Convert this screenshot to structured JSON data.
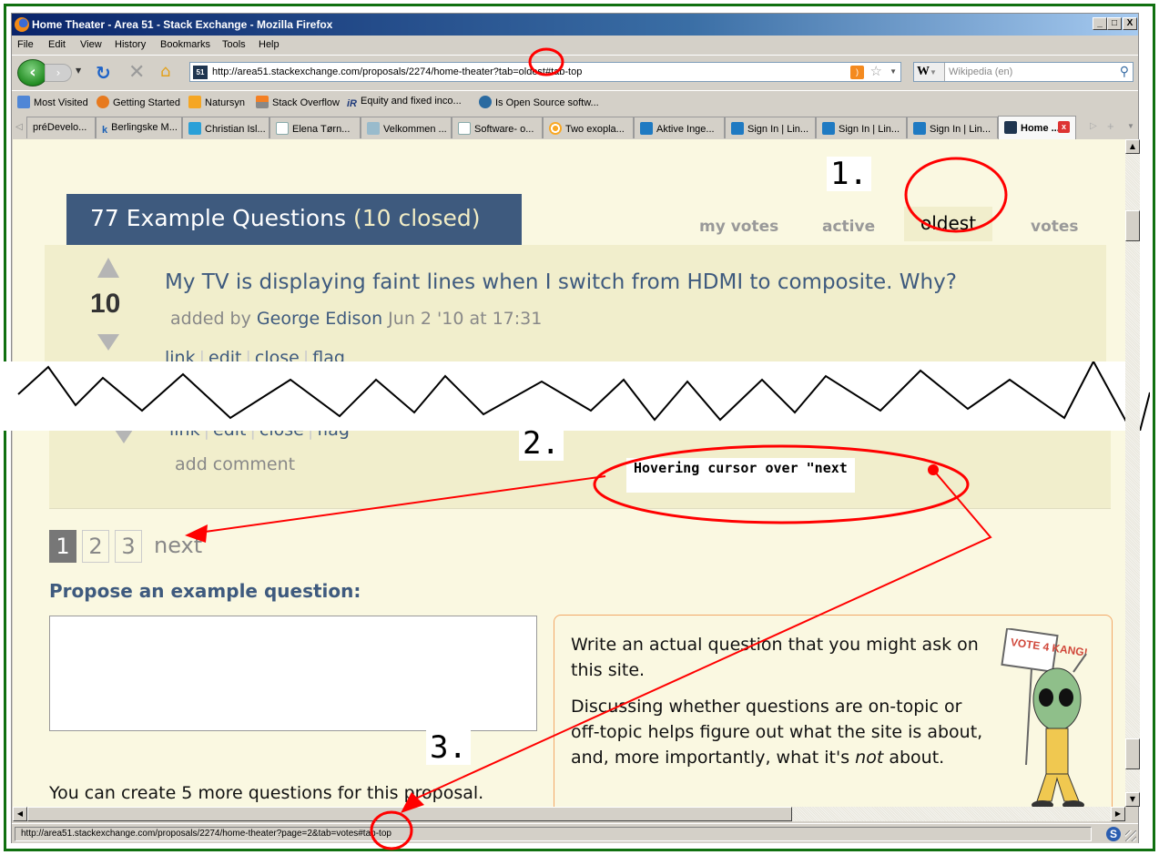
{
  "window": {
    "title": "Home Theater - Area 51 - Stack Exchange - Mozilla Firefox",
    "controls": [
      "_",
      "□",
      "X"
    ]
  },
  "menu": [
    "File",
    "Edit",
    "View",
    "History",
    "Bookmarks",
    "Tools",
    "Help"
  ],
  "navbar": {
    "url": "http://area51.stackexchange.com/proposals/2274/home-theater?tab=oldest#tab-top",
    "site_icon": "51",
    "search_engine": "W",
    "search_placeholder": "Wikipedia (en)"
  },
  "bookmarks": [
    {
      "label": "Most Visited",
      "icon": "most-visited-icon"
    },
    {
      "label": "Getting Started",
      "icon": "firefox-icon"
    },
    {
      "label": "Natursyn",
      "icon": "rss-icon"
    },
    {
      "label": "Stack Overflow",
      "icon": "stackoverflow-icon"
    },
    {
      "label": "Equity and fixed inco...",
      "icon": "ir-icon"
    },
    {
      "label": "Is Open Source softw...",
      "icon": "wordpress-icon"
    }
  ],
  "tabs": [
    {
      "label": "préDevelo...",
      "icon": "none"
    },
    {
      "label": "Berlingske M...",
      "icon": "k-icon"
    },
    {
      "label": "Christian Isl...",
      "icon": "it-icon"
    },
    {
      "label": "Elena Tørn...",
      "icon": "page-icon"
    },
    {
      "label": "Velkommen ...",
      "icon": "velkommen-icon"
    },
    {
      "label": "Software- o...",
      "icon": "page-icon"
    },
    {
      "label": "Two exopla...",
      "icon": "target-icon"
    },
    {
      "label": "Aktive Inge...",
      "icon": "linkedin-icon"
    },
    {
      "label": "Sign In | Lin...",
      "icon": "linkedin-icon"
    },
    {
      "label": "Sign In | Lin...",
      "icon": "linkedin-icon"
    },
    {
      "label": "Sign In | Lin...",
      "icon": "linkedin-icon"
    },
    {
      "label": "Home ...",
      "icon": "area51-icon",
      "active": true
    }
  ],
  "page": {
    "header_count": "77 Example Questions",
    "header_closed": "(10 closed)",
    "sort_tabs": [
      {
        "label": "my votes",
        "active": false
      },
      {
        "label": "active",
        "active": false
      },
      {
        "label": "oldest",
        "active": true
      },
      {
        "label": "votes",
        "active": false
      }
    ],
    "question": {
      "votes": "10",
      "title": "My TV is displaying faint lines when I switch from HDMI to composite. Why?",
      "added_by_prefix": "added by",
      "author": "George Edison",
      "date": "Jun 2 '10 at 17:31",
      "links": [
        "link",
        "edit",
        "close",
        "flag"
      ]
    },
    "last_question_links": [
      "link",
      "edit",
      "close",
      "flag"
    ],
    "add_comment": "add comment",
    "pagination": {
      "current": "1",
      "pages": [
        "2",
        "3"
      ],
      "next": "next"
    },
    "propose_title": "Propose an example question:",
    "question_input_value": "",
    "help_p1": "Write an actual question that you might ask on this site.",
    "help_p2_before": "Discussing whether questions are on-topic or off-topic helps figure out what the site is about, and, more importantly, what it's ",
    "help_p2_em": "not",
    "help_p2_after": " about.",
    "mascot_sign": "VOTE 4 KANG!",
    "quota": "You can create 5 more questions for this proposal."
  },
  "status": {
    "text": "http://area51.stackexchange.com/proposals/2274/home-theater?page=2&tab=votes#tab-top",
    "addon_icon": "S"
  },
  "annotations": {
    "n1": "1.",
    "n2": "2.",
    "n3": "3.",
    "hover_note": "Hovering cursor over \"next",
    "accent_color": "#ff0000"
  }
}
